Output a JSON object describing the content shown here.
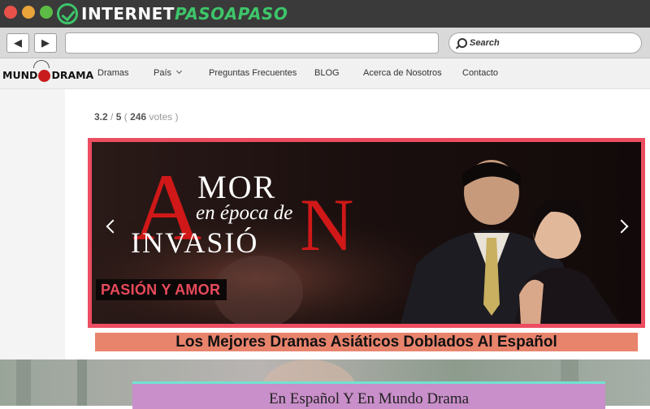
{
  "browser": {
    "brand": {
      "prefix": "INTERNET",
      "highlight": "PASOAPASO"
    },
    "nav": {
      "back": "◀",
      "forward": "▶"
    },
    "search_label": "Search"
  },
  "site": {
    "logo": {
      "left": "MUND",
      "right": "DRAMA"
    },
    "menu": [
      {
        "label": "Dramas"
      },
      {
        "label": "País"
      },
      {
        "label": "Preguntas Frecuentes"
      },
      {
        "label": "BLOG"
      },
      {
        "label": "Acerca de Nosotros"
      },
      {
        "label": "Contacto"
      }
    ]
  },
  "rating": {
    "score": "3.2",
    "max": "5",
    "votes": "246",
    "votes_label": "votes"
  },
  "banner": {
    "title": {
      "big_a": "A",
      "mor": "MOR",
      "epoca": "en época de",
      "invasio": "INVASIÓ",
      "big_n": "N"
    },
    "tagline": "PASIÓN Y AMOR"
  },
  "headline": "Los Mejores Dramas Asiáticos Doblados Al Español",
  "subheading": "En Español Y En Mundo Drama",
  "colors": {
    "accent_red": "#d01818",
    "banner_border": "#ec4d61",
    "headline_bg": "#e8836c",
    "sub_bg": "#c98fca",
    "sub_border": "#72e2d1"
  }
}
